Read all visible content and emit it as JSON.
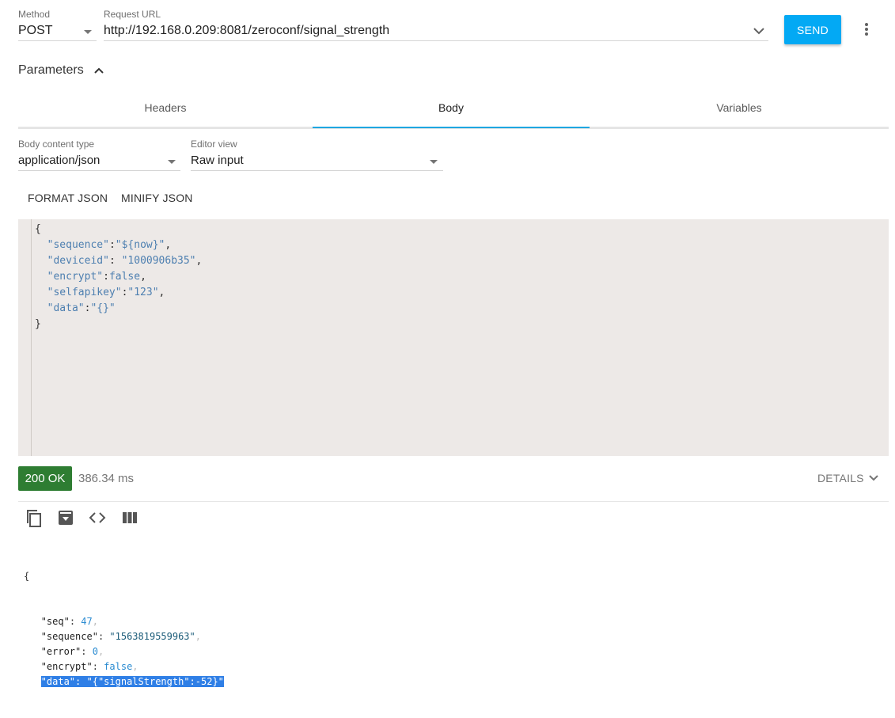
{
  "request": {
    "method_label": "Method",
    "method_value": "POST",
    "url_label": "Request URL",
    "url_value": "http://192.168.0.209:8081/zeroconf/signal_strength",
    "send_label": "SEND"
  },
  "parameters": {
    "label": "Parameters"
  },
  "tabs": [
    {
      "label": "Headers",
      "active": false
    },
    {
      "label": "Body",
      "active": true
    },
    {
      "label": "Variables",
      "active": false
    }
  ],
  "body_options": {
    "content_type_label": "Body content type",
    "content_type_value": "application/json",
    "editor_view_label": "Editor view",
    "editor_view_value": "Raw input"
  },
  "json_actions": {
    "format": "FORMAT JSON",
    "minify": "MINIFY JSON"
  },
  "editor_lines": [
    {
      "text": "{"
    },
    {
      "key": "\"sequence\"",
      "sep": ":",
      "val": "\"${now}\"",
      "end": ","
    },
    {
      "key": "\"deviceid\"",
      "sep": ": ",
      "val": "\"1000906b35\"",
      "end": ","
    },
    {
      "key": "\"encrypt\"",
      "sep": ":",
      "val": "false",
      "end": ","
    },
    {
      "key": "\"selfapikey\"",
      "sep": ":",
      "val": "\"123\"",
      "end": ","
    },
    {
      "key": "\"data\"",
      "sep": ":",
      "val": "\"{}\"",
      "end": ""
    },
    {
      "text": "}"
    }
  ],
  "response": {
    "status": "200 OK",
    "elapsed": "386.34 ms",
    "details_label": "DETAILS",
    "toolbar_icons": [
      "copy-icon",
      "save-icon",
      "code-view-icon",
      "columns-icon"
    ],
    "open_brace": "{",
    "close_brace": "}",
    "lines": [
      {
        "key": "\"seq\"",
        "val": "47",
        "kind": "num",
        "comma": ","
      },
      {
        "key": "\"sequence\"",
        "val": "\"1563819559963\"",
        "kind": "str",
        "comma": ","
      },
      {
        "key": "\"error\"",
        "val": "0",
        "kind": "num",
        "comma": ","
      },
      {
        "key": "\"encrypt\"",
        "val": "false",
        "kind": "num",
        "comma": ","
      },
      {
        "key": "\"data\"",
        "val": "\"{\"signalStrength\":-52}\"",
        "kind": "str",
        "comma": "",
        "selected": true
      }
    ]
  },
  "colors": {
    "accent": "#03a9f4",
    "tab_indicator": "#1fa7e1",
    "status_ok": "#2e7d32",
    "editor_bg": "#ede9e7",
    "selection": "#2f7fe6"
  }
}
